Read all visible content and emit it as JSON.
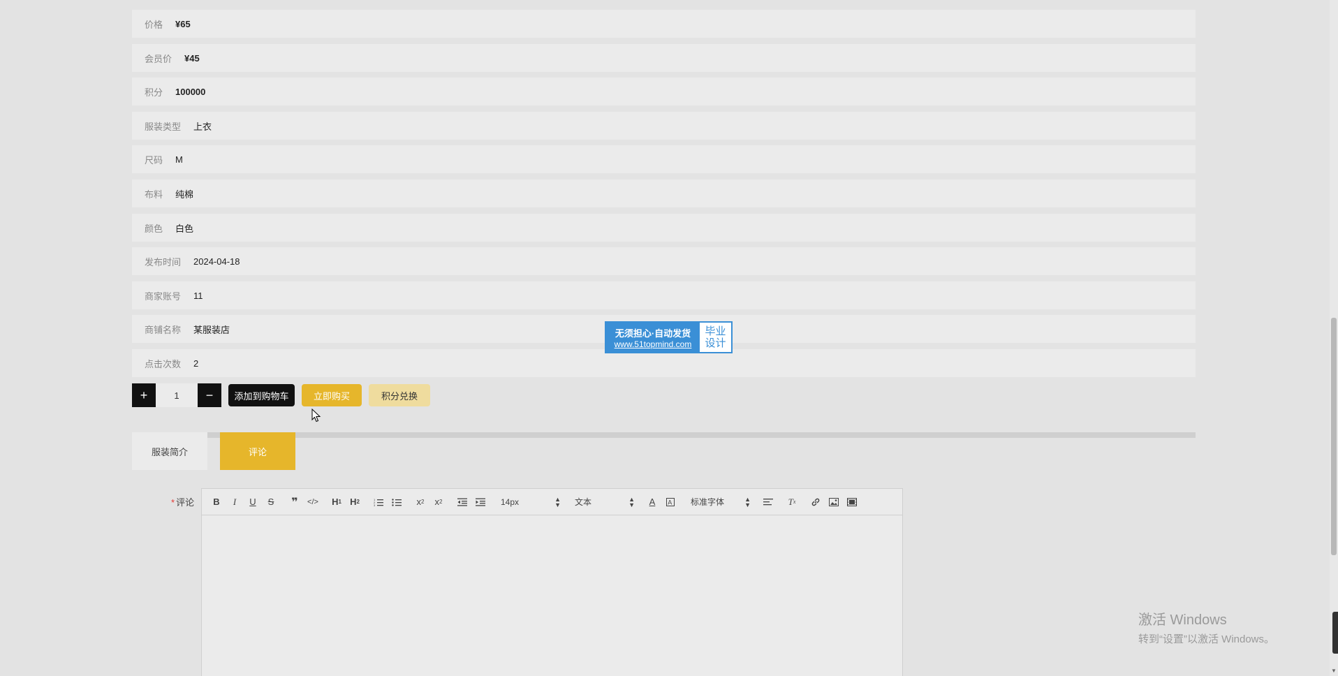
{
  "product": {
    "fields": [
      {
        "label": "价格",
        "value": "¥65",
        "bold": true
      },
      {
        "label": "会员价",
        "value": "¥45",
        "bold": true
      },
      {
        "label": "积分",
        "value": "100000",
        "bold": true
      },
      {
        "label": "服装类型",
        "value": "上衣",
        "bold": false
      },
      {
        "label": "尺码",
        "value": "M",
        "bold": false
      },
      {
        "label": "布料",
        "value": "纯棉",
        "bold": false
      },
      {
        "label": "颜色",
        "value": "白色",
        "bold": false
      },
      {
        "label": "发布时间",
        "value": "2024-04-18",
        "bold": false
      },
      {
        "label": "商家账号",
        "value": "11",
        "bold": false
      },
      {
        "label": "商铺名称",
        "value": "某服装店",
        "bold": false
      },
      {
        "label": "点击次数",
        "value": "2",
        "bold": false
      }
    ]
  },
  "actions": {
    "plus": "+",
    "minus": "−",
    "quantity": "1",
    "add_to_cart": "添加到购物车",
    "buy_now": "立即购买",
    "points_exchange": "积分兑换"
  },
  "tabs": {
    "intro": "服装简介",
    "comment": "评论"
  },
  "comment_form": {
    "required_mark": "*",
    "label": "评论",
    "font_size": "14px",
    "text_style": "文本",
    "font_family": "标准字体"
  },
  "promo": {
    "line1": "无须担心·自动发货",
    "line2": "www.51topmind.com",
    "right1": "毕业",
    "right2": "设计"
  },
  "watermark": {
    "line1": "激活 Windows",
    "line2": "转到“设置”以激活 Windows。"
  },
  "colors": {
    "accent": "#e6b62b",
    "dark": "#111111",
    "light_accent": "#efdc9e",
    "row_bg": "#ebebeb",
    "page_bg": "#e3e3e3"
  }
}
